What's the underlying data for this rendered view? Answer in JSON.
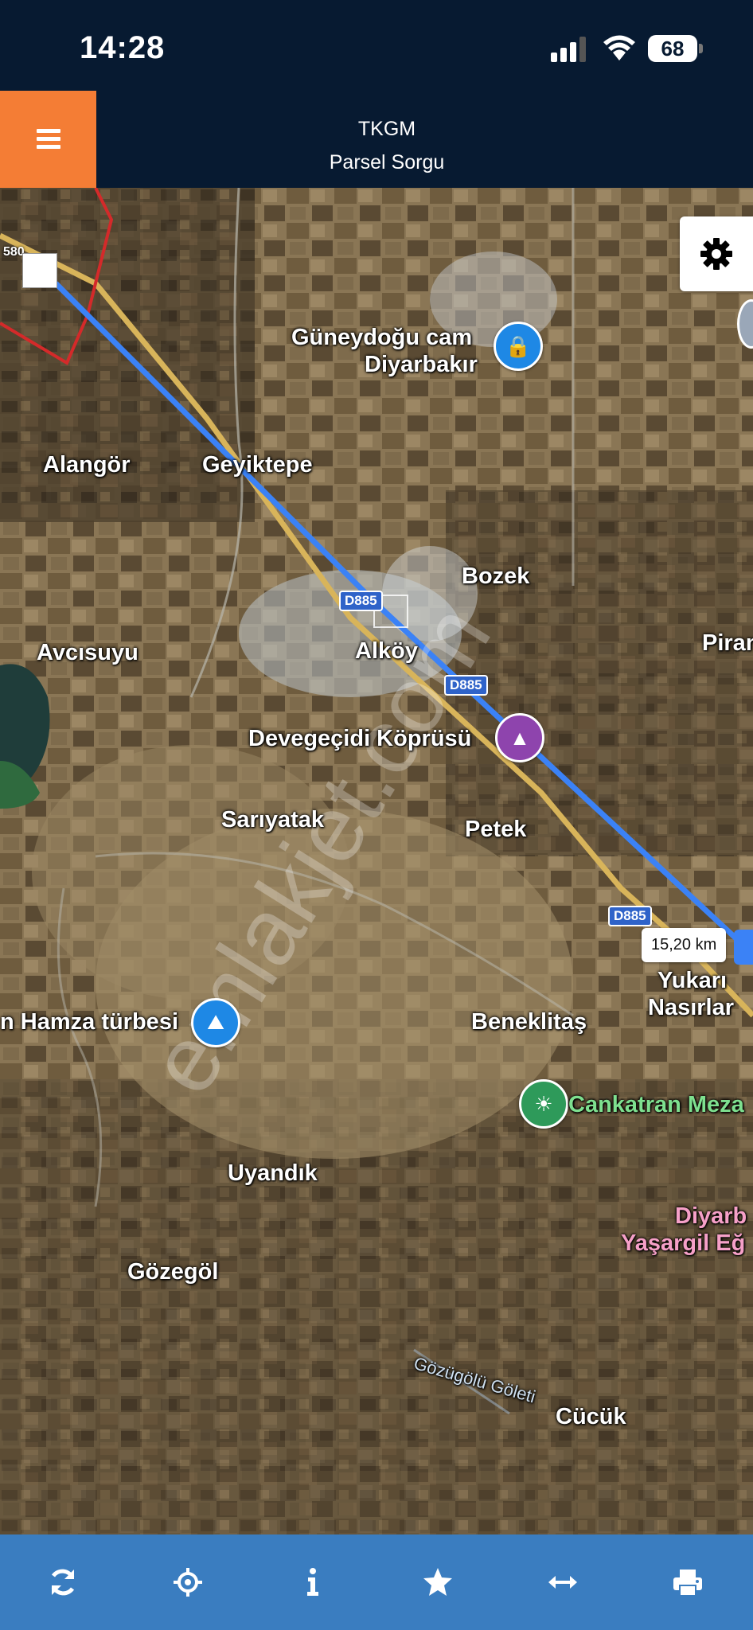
{
  "status_bar": {
    "time": "14:28",
    "battery": "68"
  },
  "header": {
    "title": "TKGM",
    "subtitle": "Parsel Sorgu"
  },
  "map": {
    "labels": {
      "guneydogu_line1": "Güneydoğu cam",
      "guneydogu_line2": "Diyarbakır",
      "alangor": "Alangör",
      "geyiktepe": "Geyiktepe",
      "bozek": "Bozek",
      "avcisuyu": "Avcısuyu",
      "alkoy": "Alköy",
      "piran": "Piran",
      "devegecidi": "Devegeçidi Köprüsü",
      "sariyatak": "Sarıyatak",
      "petek": "Petek",
      "yukari": "Yukarı",
      "nasirlar": "Nasırlar",
      "hamza": "n Hamza türbesi",
      "beneklitas": "Beneklitaş",
      "cankatran": "Cankatran Meza",
      "uyandik": "Uyandık",
      "diyarb_line1": "Diyarb",
      "diyarb_line2": "Yaşargil Eğ",
      "gozegol": "Gözegöl",
      "gozugolu": "Gözügölü Göleti",
      "cucuk": "Cücük"
    },
    "road_shields": [
      "D885",
      "D885",
      "D885"
    ],
    "parcel_number": "580",
    "distance": "15,20 km",
    "watermark": "emlakjet.com"
  },
  "colors": {
    "header_bg": "#071a31",
    "menu_accent": "#f47d35",
    "toolbar_bg": "#3a7dc0",
    "measure_line": "#3b82f6",
    "parcel_border": "#d42a2a"
  },
  "toolbar": {
    "icons": [
      "refresh-icon",
      "locate-icon",
      "info-icon",
      "favorite-icon",
      "measure-icon",
      "print-icon"
    ]
  }
}
